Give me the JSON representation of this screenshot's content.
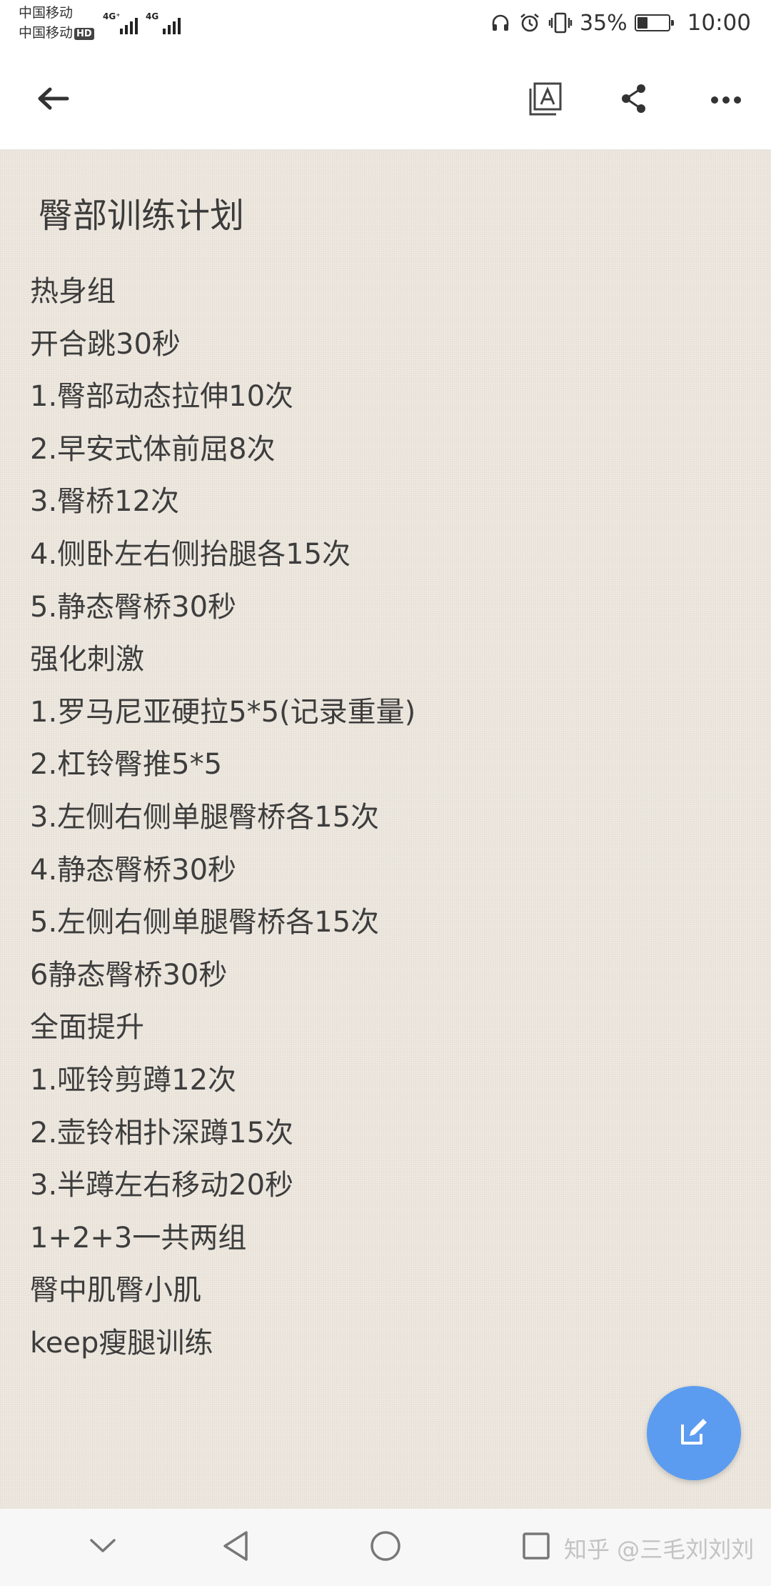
{
  "status_bar": {
    "carrier_1": "中国移动",
    "carrier_2": "中国移动",
    "hd_badge": "HD",
    "network_1": "4G⁺",
    "network_2": "4G",
    "battery_percent": "35%",
    "battery_level": 0.35,
    "time": "10:00"
  },
  "toolbar": {
    "back_icon": "arrow-left-icon",
    "translate_icon": "translate-icon",
    "share_icon": "share-icon",
    "more_icon": "more-dots-icon"
  },
  "note": {
    "title": "臀部训练计划",
    "lines": [
      "热身组",
      "开合跳30秒",
      "1.臀部动态拉伸10次",
      "2.早安式体前屈8次",
      "3.臀桥12次",
      "4.侧卧左右侧抬腿各15次",
      "5.静态臀桥30秒",
      "强化刺激",
      "1.罗马尼亚硬拉5*5(记录重量)",
      "2.杠铃臀推5*5",
      "3.左侧右侧单腿臀桥各15次",
      "4.静态臀桥30秒",
      "5.左侧右侧单腿臀桥各15次",
      "6静态臀桥30秒",
      "全面提升",
      "1.哑铃剪蹲12次",
      "2.壶铃相扑深蹲15次",
      "3.半蹲左右移动20秒",
      "1+2+3一共两组",
      "臀中肌臀小肌",
      "keep瘦腿训练"
    ]
  },
  "fab": {
    "icon": "edit-icon",
    "color": "#5b9cf0"
  },
  "nav_bar": {
    "watermark": "知乎 @三毛刘刘刘"
  }
}
